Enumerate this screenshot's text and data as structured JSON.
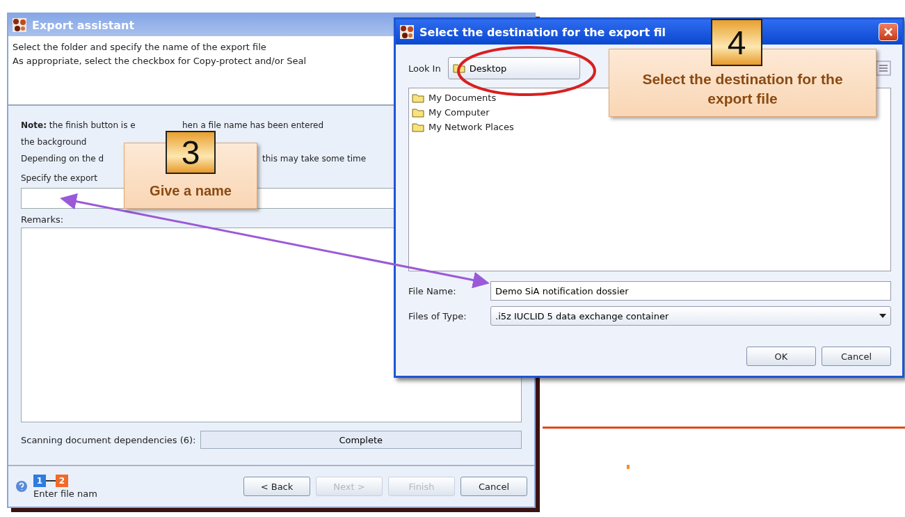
{
  "export_assistant": {
    "title": "Export assistant",
    "instructions": [
      "Select the folder and specify the name of the export file",
      "As appropriate, select the checkbox for Copy-protect and/or Seal"
    ],
    "note_lines": [
      [
        "**Note:** the finish button is e",
        "hen a file name has been entered"
      ],
      [
        "the background"
      ],
      [
        "Depending on the d",
        "this may take some time"
      ],
      [
        "Specify the export"
      ]
    ],
    "remarks_label": "Remarks:",
    "scanning_label": "Scanning document dependencies (6):",
    "scanning_status": "Complete",
    "steps": [
      {
        "label": "1",
        "color": "#2f7be0"
      },
      {
        "label": "2",
        "color": "#f06a2a"
      }
    ],
    "status_text": "Enter file nam",
    "buttons": [
      {
        "label": "< Back",
        "disabled": false
      },
      {
        "label": "Next >",
        "disabled": true
      },
      {
        "label": "Finish",
        "disabled": true
      },
      {
        "label": "Cancel",
        "disabled": false
      }
    ]
  },
  "file_dialog": {
    "title": "Select the destination for the export fil",
    "look_in_label": "Look In",
    "look_in_value": "Desktop",
    "items": [
      "My Documents",
      "My Computer",
      "My Network Places"
    ],
    "file_name_label": "File Name:",
    "file_name_value": "Demo SiA notification dossier",
    "file_type_label": "Files of Type:",
    "file_type_value": ".i5z IUCLID 5 data exchange container",
    "buttons": [
      "OK",
      "Cancel"
    ]
  },
  "callouts": [
    {
      "number": "3",
      "text": "Give a name"
    },
    {
      "number": "4",
      "text": "Select the destination for the export file"
    }
  ]
}
